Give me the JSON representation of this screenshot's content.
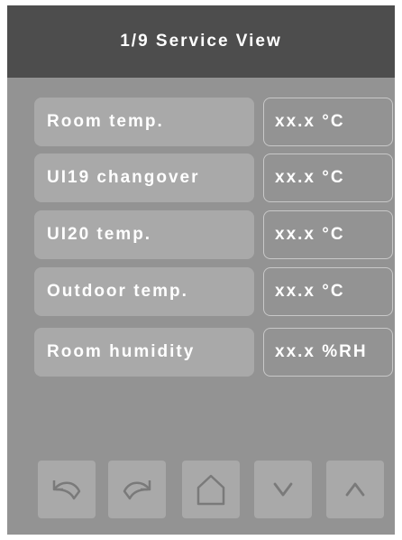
{
  "header": {
    "title": "1/9 Service View"
  },
  "rows": [
    {
      "label": "Room temp.",
      "value": "xx.x °C"
    },
    {
      "label": "UI19 changover",
      "value": "xx.x °C"
    },
    {
      "label": "UI20 temp.",
      "value": "xx.x °C"
    },
    {
      "label": "Outdoor temp.",
      "value": "xx.x °C"
    },
    {
      "label": "Room humidity",
      "value": "xx.x %RH"
    }
  ],
  "nav": {
    "icons": [
      "undo-icon",
      "redo-icon",
      "home-icon",
      "chevron-down-icon",
      "chevron-up-icon"
    ]
  },
  "colors": {
    "background": "#939393",
    "header": "#4d4d4d",
    "button": "#a9a9a9",
    "text": "#ffffff"
  }
}
